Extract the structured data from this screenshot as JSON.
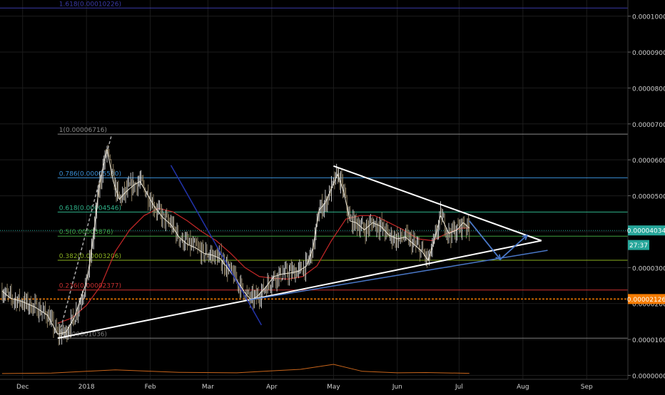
{
  "chart_data": {
    "type": "line",
    "chart_style": "candlestick",
    "title": "",
    "xlabel": "",
    "ylabel": "",
    "x_ticks": [
      "Dec",
      "2018",
      "Feb",
      "Mar",
      "Apr",
      "May",
      "Jun",
      "Jul",
      "Aug",
      "Sep"
    ],
    "x_tick_dates": [
      "2017-12-01",
      "2018-01-01",
      "2018-02-01",
      "2018-03-01",
      "2018-04-01",
      "2018-05-01",
      "2018-06-01",
      "2018-07-01",
      "2018-08-01",
      "2018-09-01"
    ],
    "y_ticks": [
      "0.00000000",
      "0.00001000",
      "0.00002000",
      "0.00003000",
      "0.00004000",
      "0.00005000",
      "0.00006000",
      "0.00007000",
      "0.00008000",
      "0.00009000",
      "0.00010000"
    ],
    "ylim": [
      -1.1e-06,
      0.0001045
    ],
    "xlim": [
      "2017-11-20",
      "2018-09-21"
    ],
    "grid": true,
    "fib_levels": [
      {
        "label": "1.618(0.00010226)",
        "value": 0.00010226,
        "color": "#3a3aa8"
      },
      {
        "label": "1(0.00006716)",
        "value": 6.716e-05,
        "color": "#8a8a8a"
      },
      {
        "label": "0.786(0.00005500)",
        "value": 5.5e-05,
        "color": "#3a8fd6"
      },
      {
        "label": "0.618(0.00004546)",
        "value": 4.546e-05,
        "color": "#2fb38a"
      },
      {
        "label": "0.5(0.00003876)",
        "value": 3.876e-05,
        "color": "#3fa03f"
      },
      {
        "label": "0.382(0.00003206)",
        "value": 3.206e-05,
        "color": "#8ab020"
      },
      {
        "label": "0.236(0.00002377)",
        "value": 2.377e-05,
        "color": "#c83030"
      },
      {
        "label": "0(0.00001036)",
        "value": 1.036e-05,
        "color": "#7a7a7a"
      }
    ],
    "price_series": {
      "name": "",
      "x": [
        "2017-11-21",
        "2017-11-25",
        "2017-12-01",
        "2017-12-07",
        "2017-12-13",
        "2017-12-18",
        "2017-12-22",
        "2017-12-26",
        "2017-12-29",
        "2018-01-01",
        "2018-01-03",
        "2018-01-05",
        "2018-01-07",
        "2018-01-09",
        "2018-01-11",
        "2018-01-14",
        "2018-01-17",
        "2018-01-20",
        "2018-01-24",
        "2018-01-27",
        "2018-01-30",
        "2018-02-03",
        "2018-02-07",
        "2018-02-11",
        "2018-02-15",
        "2018-02-19",
        "2018-02-23",
        "2018-02-27",
        "2018-03-03",
        "2018-03-07",
        "2018-03-11",
        "2018-03-15",
        "2018-03-19",
        "2018-03-22",
        "2018-03-25",
        "2018-03-29",
        "2018-04-02",
        "2018-04-06",
        "2018-04-10",
        "2018-04-14",
        "2018-04-18",
        "2018-04-21",
        "2018-04-24",
        "2018-04-27",
        "2018-04-30",
        "2018-05-03",
        "2018-05-06",
        "2018-05-09",
        "2018-05-12",
        "2018-05-16",
        "2018-05-20",
        "2018-05-24",
        "2018-05-28",
        "2018-06-01",
        "2018-06-05",
        "2018-06-09",
        "2018-06-13",
        "2018-06-16",
        "2018-06-19",
        "2018-06-22",
        "2018-06-26",
        "2018-06-30",
        "2018-07-03",
        "2018-07-06"
      ],
      "values": [
        2.35e-05,
        2.15e-05,
        2.05e-05,
        1.9e-05,
        1.68e-05,
        1.15e-05,
        1.2e-05,
        1.6e-05,
        2.1e-05,
        2.6e-05,
        3.3e-05,
        4.2e-05,
        5.2e-05,
        5.8e-05,
        6.3e-05,
        5.4e-05,
        4.9e-05,
        5.1e-05,
        5.3e-05,
        5.4e-05,
        5.1e-05,
        4.7e-05,
        4.4e-05,
        4.2e-05,
        3.85e-05,
        3.65e-05,
        3.55e-05,
        3.4e-05,
        3.35e-05,
        3.25e-05,
        2.95e-05,
        2.65e-05,
        2.3e-05,
        2.1e-05,
        2.2e-05,
        2.45e-05,
        2.75e-05,
        2.82e-05,
        2.85e-05,
        2.9e-05,
        3.05e-05,
        3.55e-05,
        4.6e-05,
        4.8e-05,
        5.2e-05,
        5.6e-05,
        5.1e-05,
        4.3e-05,
        4.25e-05,
        4.05e-05,
        4.25e-05,
        4.15e-05,
        3.9e-05,
        3.8e-05,
        3.85e-05,
        3.65e-05,
        3.45e-05,
        3.2e-05,
        3.75e-05,
        4.45e-05,
        3.95e-05,
        4.05e-05,
        4.25e-05,
        4.1e-05
      ]
    },
    "moving_average": {
      "name": "",
      "color": "#c62828",
      "x": [
        "2017-12-18",
        "2017-12-25",
        "2018-01-01",
        "2018-01-08",
        "2018-01-15",
        "2018-01-22",
        "2018-01-29",
        "2018-02-05",
        "2018-02-12",
        "2018-02-19",
        "2018-02-26",
        "2018-03-05",
        "2018-03-12",
        "2018-03-19",
        "2018-03-26",
        "2018-04-02",
        "2018-04-09",
        "2018-04-16",
        "2018-04-23",
        "2018-04-30",
        "2018-05-07",
        "2018-05-14",
        "2018-05-21",
        "2018-05-28",
        "2018-06-04",
        "2018-06-11",
        "2018-06-18",
        "2018-06-25",
        "2018-07-02",
        "2018-07-06"
      ],
      "values": [
        1.45e-05,
        1.6e-05,
        1.95e-05,
        2.5e-05,
        3.45e-05,
        4.05e-05,
        4.45e-05,
        4.65e-05,
        4.55e-05,
        4.3e-05,
        4e-05,
        3.75e-05,
        3.4e-05,
        3e-05,
        2.75e-05,
        2.7e-05,
        2.68e-05,
        2.75e-05,
        3.05e-05,
        3.75e-05,
        4.35e-05,
        4.45e-05,
        4.45e-05,
        4.25e-05,
        4.05e-05,
        3.8e-05,
        3.75e-05,
        3.95e-05,
        4.1e-05,
        4.1e-05
      ]
    },
    "trendlines": [
      {
        "name": "",
        "color": "#ffffff",
        "points": [
          [
            "2017-12-18",
            1.036e-05
          ],
          [
            "2018-03-21",
            2.1e-05
          ],
          [
            "2018-08-10",
            3.75e-05
          ]
        ]
      },
      {
        "name": "",
        "color": "#ffffff",
        "points": [
          [
            "2018-05-01",
            5.83e-05
          ],
          [
            "2018-08-10",
            3.75e-05
          ]
        ]
      },
      {
        "name": "",
        "color": "#4a78c8",
        "points": [
          [
            "2018-03-21",
            2.1e-05
          ],
          [
            "2018-08-13",
            3.48e-05
          ]
        ]
      },
      {
        "name": "",
        "color": "#2233aa",
        "points": [
          [
            "2018-02-11",
            5.85e-05
          ],
          [
            "2018-03-27",
            1.4e-05
          ]
        ]
      },
      {
        "name": "",
        "color": "#aaaaaa",
        "points": [
          [
            "2017-12-19",
            1.2e-05
          ],
          [
            "2018-01-13",
            6.65e-05
          ]
        ]
      }
    ],
    "projection_arrow": {
      "color": "#4a78c8",
      "points": [
        [
          "2018-07-06",
          4.3e-05
        ],
        [
          "2018-07-21",
          3.23e-05
        ],
        [
          "2018-08-03",
          3.9e-05
        ]
      ]
    },
    "volume": {
      "color": "#c8651b",
      "x": [
        "2017-11-21",
        "2017-12-15",
        "2018-01-15",
        "2018-02-15",
        "2018-03-15",
        "2018-04-01",
        "2018-04-15",
        "2018-05-01",
        "2018-05-15",
        "2018-06-01",
        "2018-06-15",
        "2018-07-06"
      ],
      "values": [
        0.08,
        0.12,
        0.45,
        0.2,
        0.15,
        0.35,
        0.5,
        1.0,
        0.3,
        0.15,
        0.18,
        0.1
      ]
    },
    "horizontal_lines": [
      {
        "label": "0.00002126",
        "value": 2.126e-05,
        "color": "#f57c00",
        "style": "dashed"
      }
    ],
    "price_markers": [
      {
        "label": "0.00004034",
        "value": 4.034e-05,
        "color": "#26a69a"
      },
      {
        "label": "27:37",
        "value": 3.63e-05,
        "color": "#26a69a"
      }
    ],
    "legend": "none"
  }
}
